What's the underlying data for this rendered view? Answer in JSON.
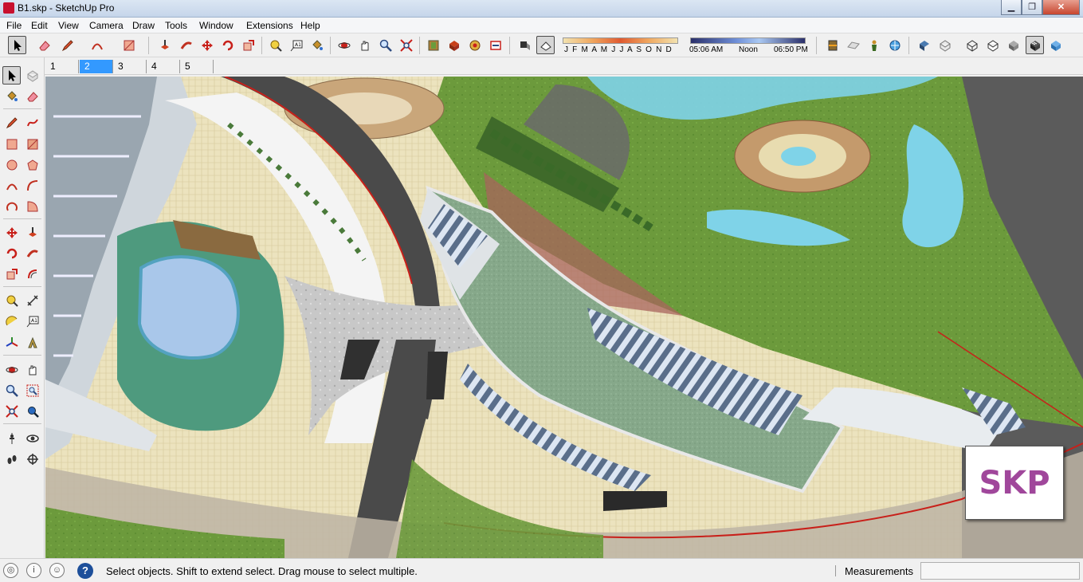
{
  "window": {
    "title": "B1.skp - SketchUp Pro",
    "minimize_glyph": "▁",
    "maximize_glyph": "❐",
    "close_glyph": "✕"
  },
  "menu": [
    "File",
    "Edit",
    "View",
    "Camera",
    "Draw",
    "Tools",
    "Window",
    "Extensions",
    "Help"
  ],
  "toolbar": {
    "tools": [
      "select-icon",
      "eraser-icon",
      "pencil-line-icon",
      "arc-icon",
      "shape-icon",
      "push-pull-icon",
      "follow-me-icon",
      "move-icon",
      "rotate-icon",
      "scale-icon",
      "tape-measure-icon",
      "text-icon",
      "paint-bucket-icon",
      "orbit-icon",
      "pan-icon",
      "zoom-icon",
      "zoom-extents-icon",
      "model-info-icon",
      "components-icon",
      "warehouse-icon",
      "extension-icon",
      "shadows-icon",
      "fog-icon"
    ],
    "shadow": {
      "months_label": "J F M A M J J A S O N D",
      "time_start": "05:06 AM",
      "time_mid": "Noon",
      "time_end": "06:50 PM"
    },
    "right_tools": [
      "section-plane-icon",
      "sandbox-icon",
      "position-camera-icon",
      "geo-location-icon",
      "style-xray-icon",
      "style-backedges-icon",
      "style-wireframe-icon",
      "style-hidden-line-icon",
      "style-shaded-icon",
      "style-textured-icon",
      "style-monochrome-icon"
    ]
  },
  "scenes": {
    "tabs": [
      "1",
      "2",
      "3",
      "4",
      "5"
    ],
    "selected": "2"
  },
  "lefttools": [
    "select-icon",
    "make-component-icon",
    "paint-bucket-icon",
    "eraser-icon",
    "pencil-line-icon",
    "freehand-icon",
    "rectangle-icon",
    "rotated-rectangle-icon",
    "circle-icon",
    "polygon-icon",
    "arc-icon",
    "two-point-arc-icon",
    "three-point-arc-icon",
    "pie-icon",
    "move-icon",
    "push-pull-icon",
    "rotate-icon",
    "follow-me-icon",
    "scale-icon",
    "offset-icon",
    "tape-measure-icon",
    "dimension-icon",
    "protractor-icon",
    "text-icon",
    "axes-icon",
    "3d-text-icon",
    "orbit-icon",
    "pan-icon",
    "zoom-icon",
    "zoom-window-icon",
    "zoom-extents-icon",
    "previous-view-icon",
    "position-camera-icon",
    "look-around-icon",
    "walk-icon",
    "section-plane-icon"
  ],
  "viewport": {
    "watermark": "SKP"
  },
  "statusbar": {
    "icons": [
      "geo-location-status-icon",
      "credits-icon",
      "user-account-icon"
    ],
    "help_glyph": "?",
    "message": "Select objects. Shift to extend select. Drag mouse to select multiple.",
    "measurements_label": "Measurements",
    "measurements_value": ""
  },
  "colors": {
    "accent_selected": "#3399ff",
    "skp_logo": "#a0479b",
    "grass": "#6f9e3e",
    "water": "#7fd3e8",
    "road": "#4a4a4a",
    "paving": "#e8dcb0"
  }
}
